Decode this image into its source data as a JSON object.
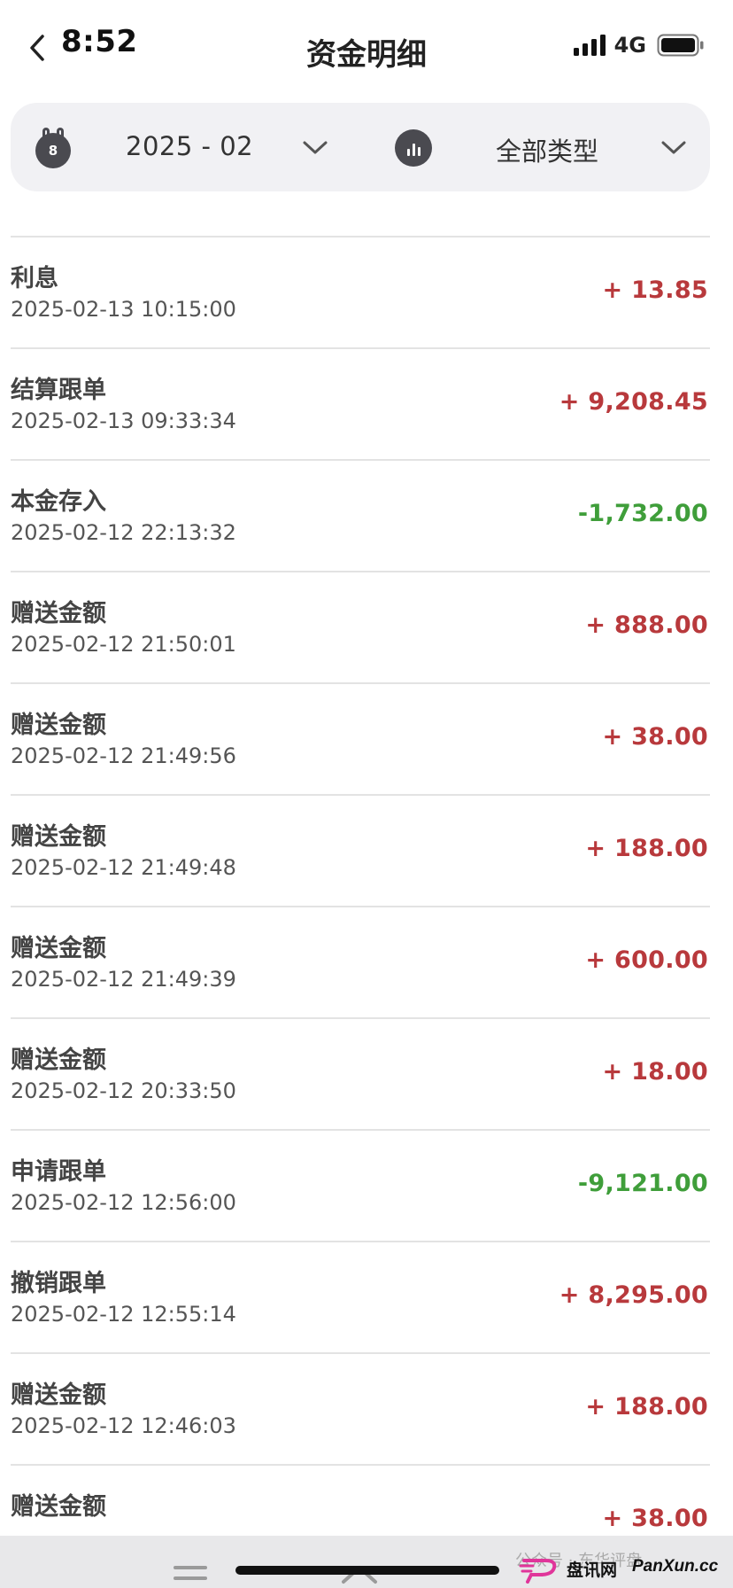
{
  "status_bar": {
    "time": "8:52",
    "network": "4G"
  },
  "header": {
    "title": "资金明细"
  },
  "filters": {
    "calendar_day": "8",
    "month": "2025 - 02",
    "type": "全部类型"
  },
  "transactions": [
    {
      "title": "利息",
      "time": "2025-02-13 10:15:00",
      "amount": "+ 13.85",
      "sign": "positive"
    },
    {
      "title": "结算跟单",
      "time": "2025-02-13 09:33:34",
      "amount": "+ 9,208.45",
      "sign": "positive"
    },
    {
      "title": "本金存入",
      "time": "2025-02-12 22:13:32",
      "amount": "-1,732.00",
      "sign": "negative"
    },
    {
      "title": "赠送金额",
      "time": "2025-02-12 21:50:01",
      "amount": "+ 888.00",
      "sign": "positive"
    },
    {
      "title": "赠送金额",
      "time": "2025-02-12 21:49:56",
      "amount": "+ 38.00",
      "sign": "positive"
    },
    {
      "title": "赠送金额",
      "time": "2025-02-12 21:49:48",
      "amount": "+ 188.00",
      "sign": "positive"
    },
    {
      "title": "赠送金额",
      "time": "2025-02-12 21:49:39",
      "amount": "+ 600.00",
      "sign": "positive"
    },
    {
      "title": "赠送金额",
      "time": "2025-02-12 20:33:50",
      "amount": "+ 18.00",
      "sign": "positive"
    },
    {
      "title": "申请跟单",
      "time": "2025-02-12 12:56:00",
      "amount": "-9,121.00",
      "sign": "negative"
    },
    {
      "title": "撤销跟单",
      "time": "2025-02-12 12:55:14",
      "amount": "+ 8,295.00",
      "sign": "positive"
    },
    {
      "title": "赠送金额",
      "time": "2025-02-12 12:46:03",
      "amount": "+ 188.00",
      "sign": "positive"
    },
    {
      "title": "赠送金额",
      "time": "",
      "amount": "+ 38.00",
      "sign": "positive"
    }
  ],
  "colors": {
    "positive": "#b8393c",
    "negative": "#3f9e3a"
  },
  "watermark": {
    "source": "公众号 · 东华评盘",
    "brand": "盘讯网",
    "url": "PanXun.cc"
  }
}
